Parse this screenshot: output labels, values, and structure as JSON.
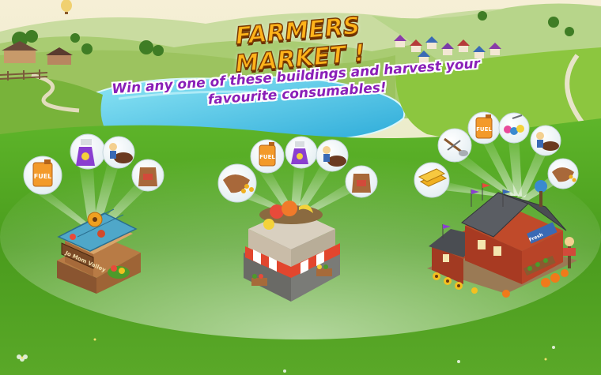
{
  "banner": {
    "title": "FARMERS MARKET !",
    "subtitle_line1": "Win any one of these buildings and harvest your",
    "subtitle_line2": "favourite consumables!"
  },
  "buildings": [
    {
      "sign": "Jo Mom Valley",
      "items": [
        "fuel-can-icon",
        "spray-bottle-icon",
        "farmer-with-cow-icon",
        "feed-sack-icon"
      ]
    },
    {
      "items": [
        "seed-sack-icon",
        "fuel-can-icon",
        "spray-bottle-icon",
        "farmer-with-cow-icon",
        "feed-sack-icon"
      ]
    },
    {
      "sign": "Fresh",
      "items": [
        "gold-bars-icon",
        "shovel-tools-icon",
        "fuel-can-icon",
        "balloons-icon",
        "farmer-with-cow-icon",
        "seed-sack-icon"
      ]
    }
  ],
  "fuel_label": "FUEL",
  "colors": {
    "title": "#ffb31a",
    "subtitle": "#8a1fb8",
    "grass": "#4fa61b",
    "lake": "#3ec3e6"
  }
}
